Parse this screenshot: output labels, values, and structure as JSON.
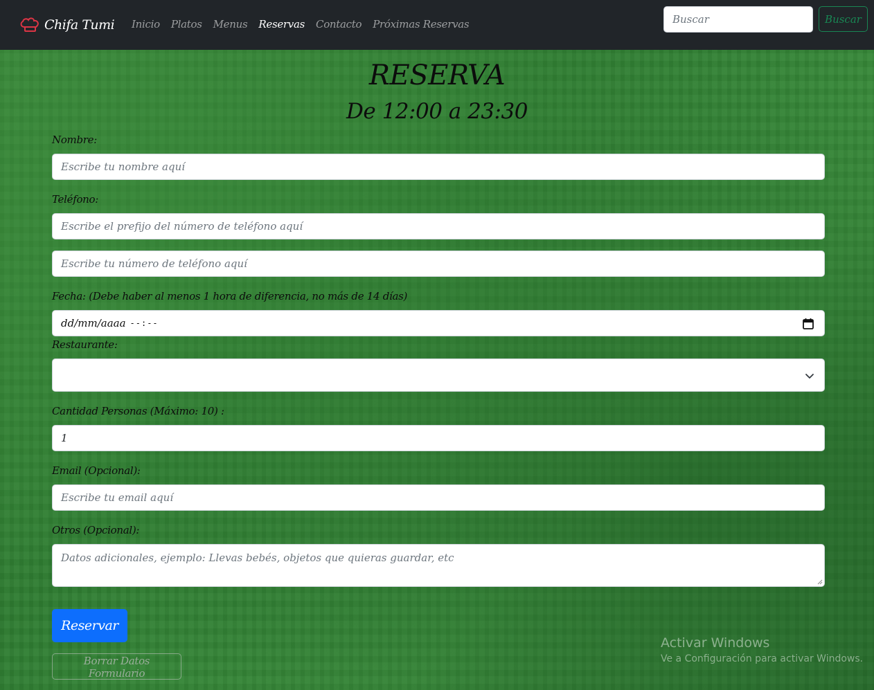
{
  "navbar": {
    "brand": "Chifa Tumi",
    "brand_icon": "chef-hat-icon",
    "brand_icon_color": "#dc3545",
    "links": [
      {
        "label": "Inicio",
        "active": false
      },
      {
        "label": "Platos",
        "active": false
      },
      {
        "label": "Menus",
        "active": false
      },
      {
        "label": "Reservas",
        "active": true
      },
      {
        "label": "Contacto",
        "active": false
      },
      {
        "label": "Próximas Reservas",
        "active": false
      }
    ],
    "search_placeholder": "Buscar",
    "search_button": "Buscar"
  },
  "header": {
    "title": "RESERVA",
    "subtitle": "De 12:00 a 23:30"
  },
  "form": {
    "nombre_label": "Nombre:",
    "nombre_placeholder": "Escribe tu nombre aquí",
    "telefono_label": "Teléfono:",
    "prefijo_placeholder": "Escribe el prefijo del número de teléfono aquí",
    "telefono_placeholder": "Escribe tu número de teléfono aquí",
    "fecha_label": "Fecha: (Debe haber al menos 1 hora de diferencia, no más de 14 días)",
    "fecha_date_placeholder": "dd/mm/aaaa",
    "fecha_time_placeholder": "--:--",
    "restaurante_label": "Restaurante:",
    "restaurante_value": "",
    "cantidad_label": "Cantidad Personas (Máximo: 10) :",
    "cantidad_value": "1",
    "email_label": "Email (Opcional):",
    "email_placeholder": "Escribe tu email aquí",
    "otros_label": "Otros (Opcional):",
    "otros_placeholder": "Datos adicionales, ejemplo: Llevas bebés, objetos que quieras guardar, etc",
    "submit_button": "Reservar",
    "reset_button": "Borrar Datos Formulario"
  },
  "watermark": {
    "title": "Activar Windows",
    "subtitle": "Ve a Configuración para activar Windows."
  },
  "colors": {
    "navbar_bg": "#212529",
    "primary": "#0d6efd",
    "success": "#198754",
    "background_green": "#2f7d32"
  }
}
